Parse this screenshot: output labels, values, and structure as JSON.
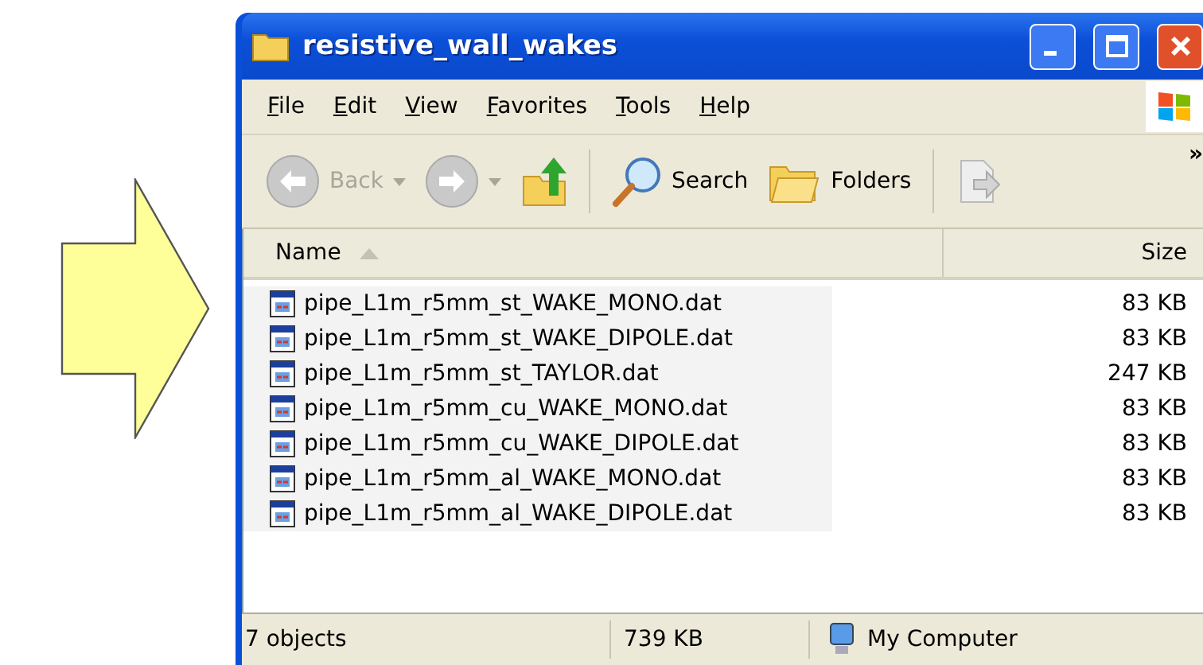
{
  "window": {
    "title": "resistive_wall_wakes"
  },
  "menu": [
    "File",
    "Edit",
    "View",
    "Favorites",
    "Tools",
    "Help"
  ],
  "toolbar": [
    {
      "kind": "back",
      "label": "Back",
      "disabled": true
    },
    {
      "kind": "forward",
      "disabled": true
    },
    {
      "kind": "up"
    },
    {
      "kind": "search",
      "label": "Search"
    },
    {
      "kind": "folders",
      "label": "Folders"
    },
    {
      "kind": "move",
      "disabled": true
    },
    {
      "kind": "more",
      "label": "»"
    }
  ],
  "columns": [
    {
      "label": "Name",
      "sorted": true
    },
    {
      "label": "Size",
      "sorted": false
    }
  ],
  "files": [
    {
      "name": "pipe_L1m_r5mm_st_WAKE_MONO.dat",
      "size": "83 KB",
      "selected": true
    },
    {
      "name": "pipe_L1m_r5mm_st_WAKE_DIPOLE.dat",
      "size": "83 KB",
      "selected": true
    },
    {
      "name": "pipe_L1m_r5mm_st_TAYLOR.dat",
      "size": "247 KB",
      "selected": true
    },
    {
      "name": "pipe_L1m_r5mm_cu_WAKE_MONO.dat",
      "size": "83 KB",
      "selected": true
    },
    {
      "name": "pipe_L1m_r5mm_cu_WAKE_DIPOLE.dat",
      "size": "83 KB",
      "selected": true
    },
    {
      "name": "pipe_L1m_r5mm_al_WAKE_MONO.dat",
      "size": "83 KB",
      "selected": true
    },
    {
      "name": "pipe_L1m_r5mm_al_WAKE_DIPOLE.dat",
      "size": "83 KB",
      "selected": true
    }
  ],
  "status_bar": {
    "objects": "7 objects",
    "total": "739 KB",
    "zone": "My Computer"
  }
}
